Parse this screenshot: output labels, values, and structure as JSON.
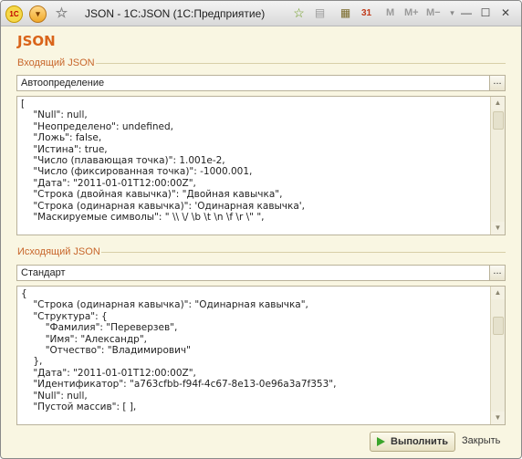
{
  "window": {
    "title": "JSON - 1С:JSON  (1С:Предприятие)",
    "app_logo_text": "1С",
    "minimize": "—",
    "maximize": "☐",
    "close": "✕",
    "tools": {
      "m": "M",
      "m_plus": "M+",
      "m_minus": "M−"
    }
  },
  "form": {
    "title": "JSON"
  },
  "input": {
    "group_label": "Входящий JSON",
    "mode": "Автоопределение",
    "select_button": "...",
    "text": "[\n    \"Null\": null,\n    \"Неопределено\": undefined,\n    \"Ложь\": false,\n    \"Истина\": true,\n    \"Число (плавающая точка)\": 1.001e-2,\n    \"Число (фиксированная точка)\": -1000.001,\n    \"Дата\": \"2011-01-01T12:00:00Z\",\n    \"Строка (двойная кавычка)\": \"Двойная кавычка\",\n    \"Строка (одинарная кавычка)\": 'Одинарная кавычка',\n    \"Маскируемые символы\": \" \\\\ \\/ \\b \\t \\n \\f \\r \\\" \","
  },
  "output": {
    "group_label": "Исходящий JSON",
    "mode": "Стандарт",
    "select_button": "...",
    "text": "{\n    \"Строка (одинарная кавычка)\": \"Одинарная кавычка\",\n    \"Структура\": {\n        \"Фамилия\": \"Переверзев\",\n        \"Имя\": \"Александр\",\n        \"Отчество\": \"Владимирович\"\n    },\n    \"Дата\": \"2011-01-01T12:00:00Z\",\n    \"Идентификатор\": \"a763cfbb-f94f-4c67-8e13-0e96a3a7f353\",\n    \"Null\": null,\n    \"Пустой массив\": [ ],"
  },
  "actions": {
    "run": "Выполнить",
    "close": "Закрыть"
  },
  "colors": {
    "accent": "#d9641a",
    "form_bg": "#f9f6e2",
    "run_icon": "#3aa52b"
  }
}
